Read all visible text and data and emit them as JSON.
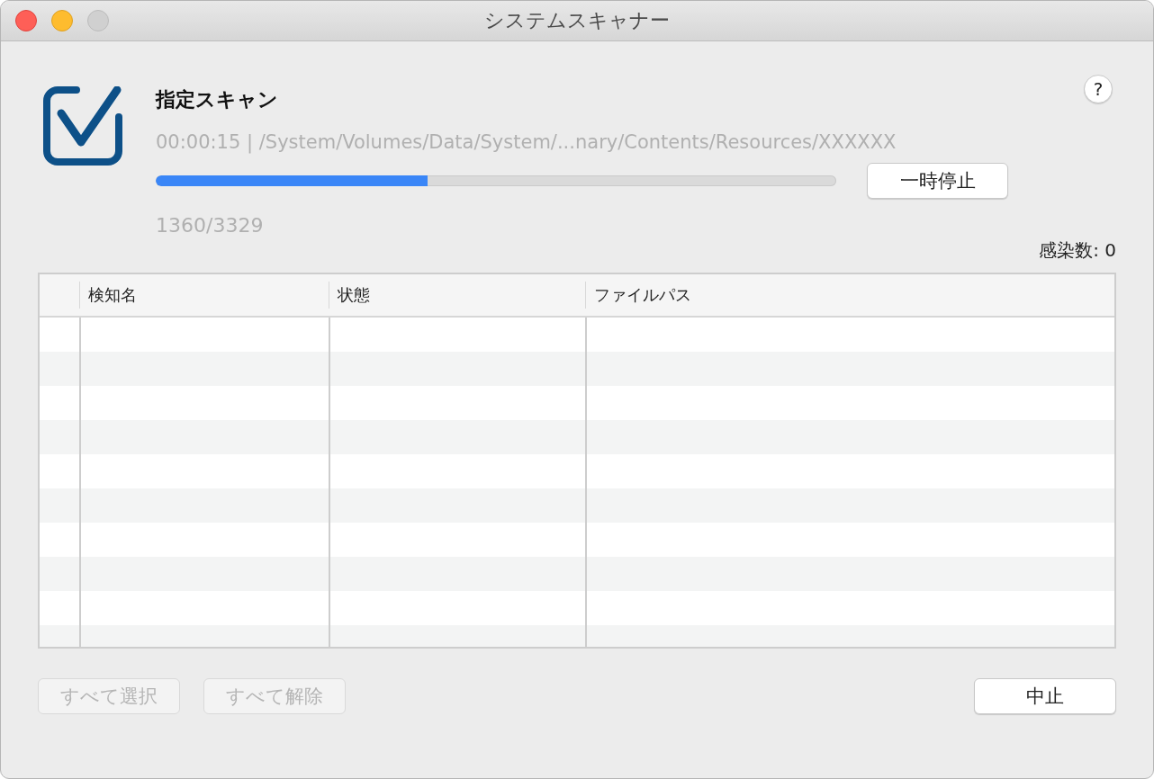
{
  "window": {
    "title": "システムスキャナー"
  },
  "scan": {
    "title": "指定スキャン",
    "status": "00:00:15 | /System/Volumes/Data/System/...nary/Contents/Resources/XXXXXX",
    "level": 0.4,
    "count": "1360/3329",
    "pause_button": "一時停止",
    "help_button": "?"
  },
  "infections": "感染数: 0",
  "table": {
    "columns": [
      "",
      "検知名",
      "状態",
      "ファイルパス"
    ]
  },
  "buttons": [
    {
      "label": "すべて選択",
      "disabled": true
    },
    {
      "label": "すべて解除",
      "disabled": true
    },
    {
      "label": "中止",
      "disabled": false
    }
  ]
}
